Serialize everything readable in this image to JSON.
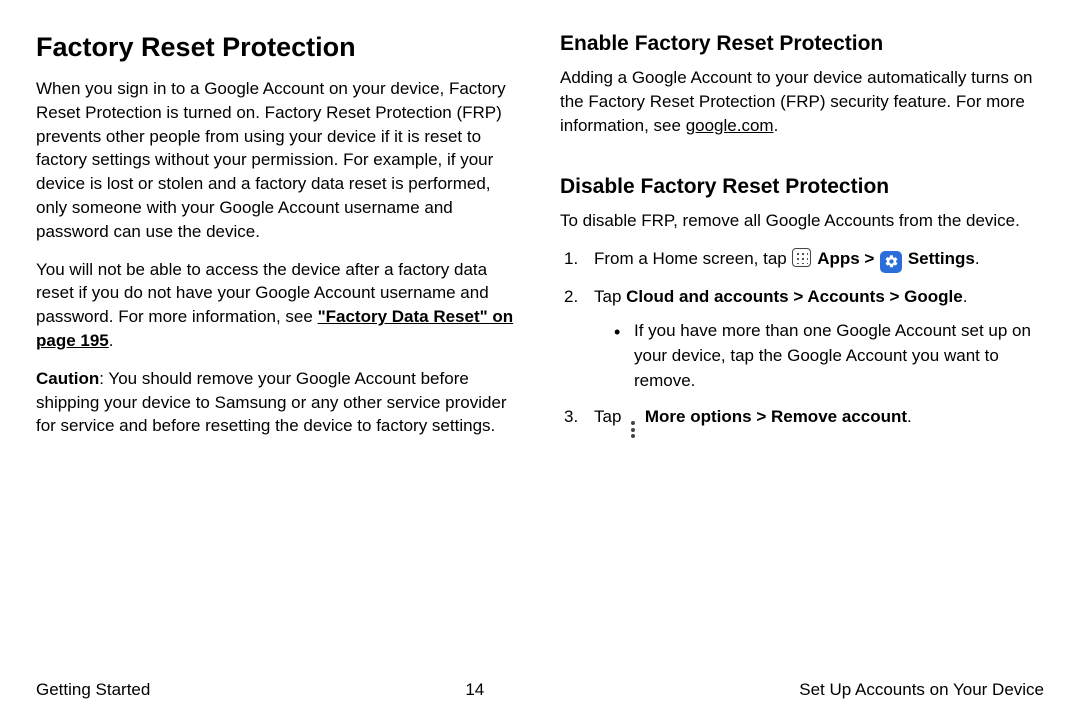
{
  "left": {
    "title": "Factory Reset Protection",
    "p1": "When you sign in to a Google Account on your device, Factory Reset Protection is turned on. Factory Reset Protection (FRP) prevents other people from using your device if it is reset to factory settings without your permission. For example, if your device is lost or stolen and a factory data reset is performed, only someone with your Google Account username and password can use the device.",
    "p2a": "You will not be able to access the device after a factory data reset if you do not have your Google Account username and password. For more information, see ",
    "p2_link": "\"Factory Data Reset\" on page 195",
    "p2b": ".",
    "p3_lead": "Caution",
    "p3": ": You should remove your Google Account before shipping your device to Samsung or any other service provider for service and before resetting the device to factory settings."
  },
  "right": {
    "h_enable": "Enable Factory Reset Protection",
    "enable_p": "Adding a Google Account to your device automatically turns on the Factory Reset Protection (FRP) security feature. For more information, see ",
    "enable_link": "google.com",
    "enable_p_tail": ".",
    "h_disable": "Disable Factory Reset Protection",
    "disable_p": "To disable FRP, remove all Google Accounts from the device.",
    "step1_a": "From a Home screen, tap ",
    "step1_apps": "Apps",
    "step1_gt": " > ",
    "step1_settings": "Settings",
    "step1_tail": ".",
    "step2_a": "Tap ",
    "step2_b": "Cloud and accounts > Accounts > Google",
    "step2_tail": ".",
    "step2_bullet": "If you have more than one Google Account set up on your device, tap the Google Account you want to remove.",
    "step3_a": "Tap ",
    "step3_b": "More options > Remove account",
    "step3_tail": "."
  },
  "footer": {
    "left": "Getting Started",
    "center": "14",
    "right": "Set Up Accounts on Your Device"
  }
}
